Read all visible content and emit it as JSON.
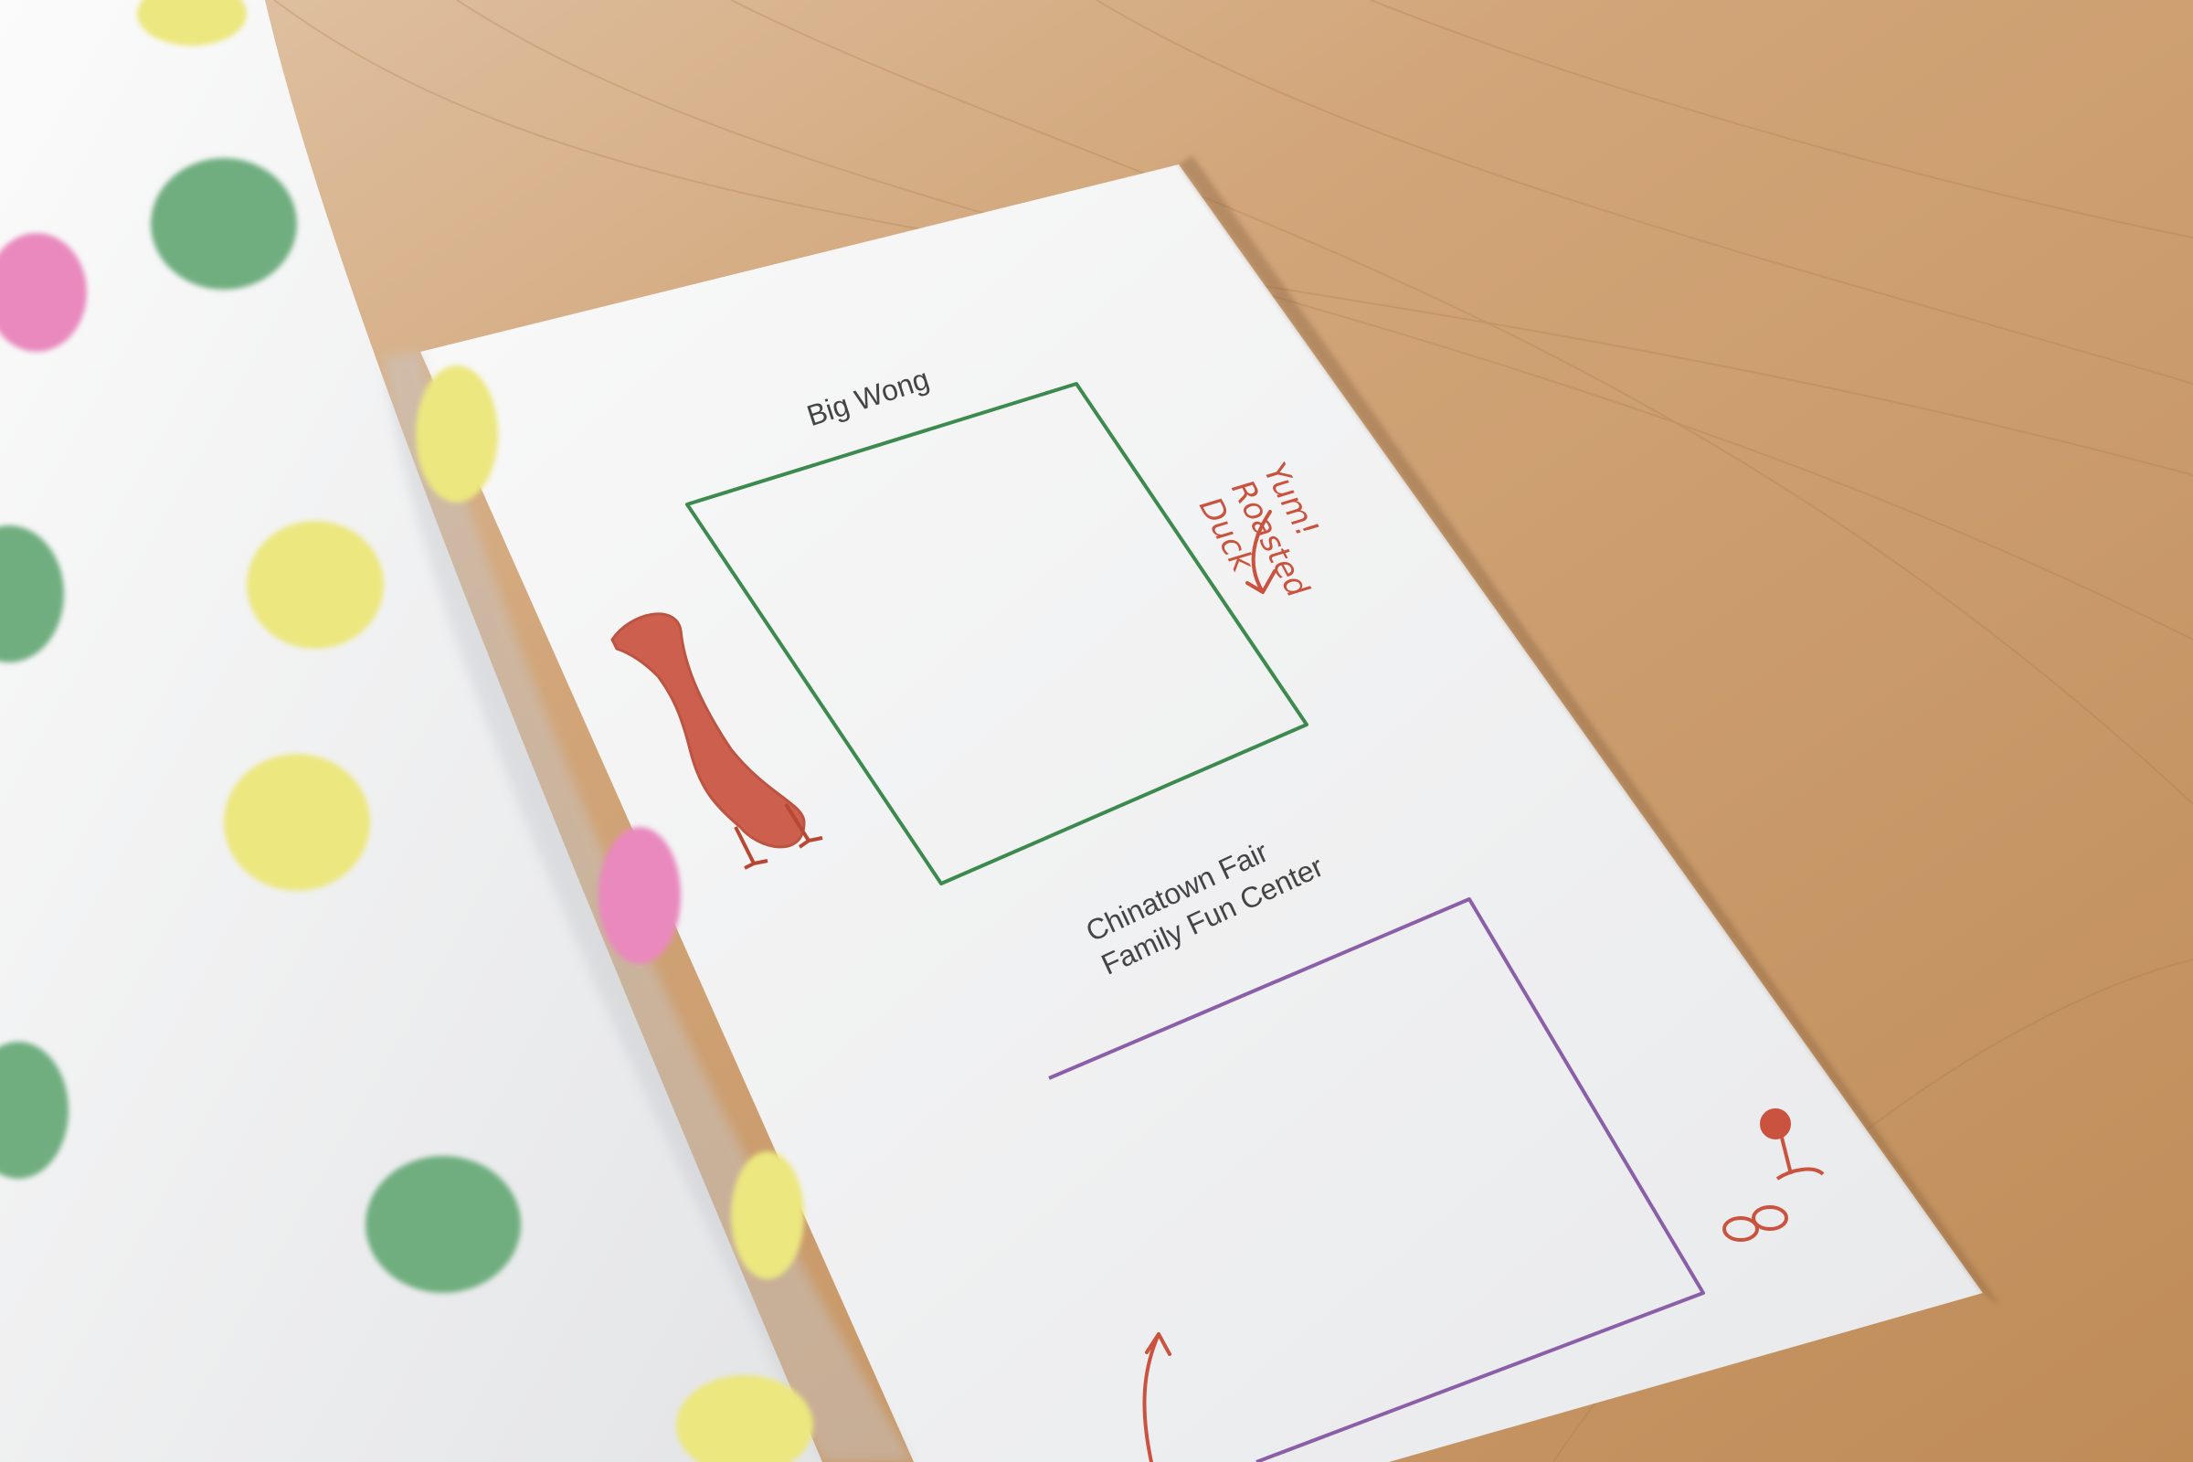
{
  "scene": {
    "description_colors": {
      "table": "#c99866",
      "page": "#f5f5f4",
      "green_frame": "#3d8a4f",
      "purple_frame": "#8a5fa8",
      "red_ink": "#c9533f",
      "dot_green": "#6fae7f",
      "dot_yellow": "#ece77f",
      "dot_pink": "#e989bd"
    }
  },
  "page": {
    "box1_label": "Big Wong",
    "box2_label_line1": "Chinatown Fair",
    "box2_label_line2": "Family Fun Center",
    "note_line1": "Yum!",
    "note_line2": "Roasted",
    "note_line3": "Duck"
  }
}
